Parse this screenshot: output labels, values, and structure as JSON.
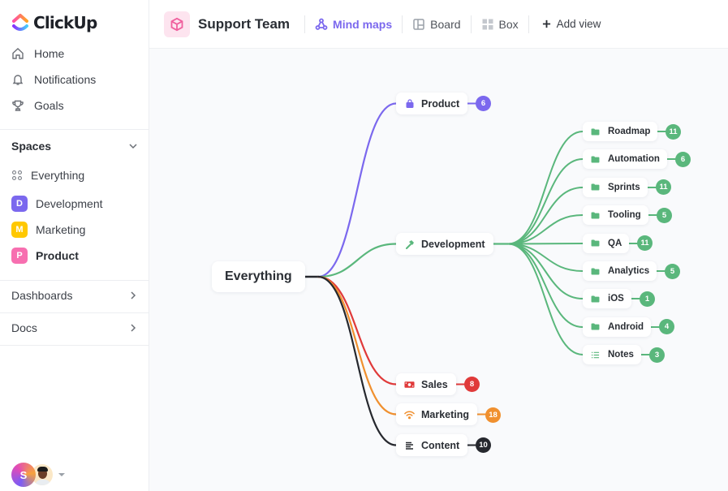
{
  "brand": {
    "name": "ClickUp"
  },
  "sidebar": {
    "nav": [
      {
        "label": "Home",
        "icon": "home-icon"
      },
      {
        "label": "Notifications",
        "icon": "bell-icon"
      },
      {
        "label": "Goals",
        "icon": "trophy-icon"
      }
    ],
    "spaces_label": "Spaces",
    "everything_label": "Everything",
    "spaces": [
      {
        "label": "Development",
        "initial": "D",
        "color": "#7b68ee"
      },
      {
        "label": "Marketing",
        "initial": "M",
        "color": "#ffc800"
      },
      {
        "label": "Product",
        "initial": "P",
        "color": "#f76fb0",
        "active": true
      }
    ],
    "dashboards_label": "Dashboards",
    "docs_label": "Docs",
    "user_initial": "S"
  },
  "header": {
    "title": "Support Team",
    "views": [
      {
        "label": "Mind maps",
        "icon": "mind-map-icon",
        "active": true
      },
      {
        "label": "Board",
        "icon": "board-icon"
      },
      {
        "label": "Box",
        "icon": "box-icon"
      }
    ],
    "add_view_label": "Add view"
  },
  "mindmap": {
    "root": "Everything",
    "colors": {
      "product": "#7b68ee",
      "development": "#5ab77c",
      "sales": "#e03a3a",
      "marketing": "#f0902f",
      "content": "#26282e"
    },
    "branches": [
      {
        "key": "product",
        "label": "Product",
        "icon": "bag-icon",
        "count": "6"
      },
      {
        "key": "development",
        "label": "Development",
        "icon": "hammer-icon",
        "count": null
      },
      {
        "key": "sales",
        "label": "Sales",
        "icon": "money-icon",
        "count": "8"
      },
      {
        "key": "marketing",
        "label": "Marketing",
        "icon": "wifi-icon",
        "count": "18"
      },
      {
        "key": "content",
        "label": "Content",
        "icon": "text-lines-icon",
        "count": "10"
      }
    ],
    "development_children": [
      {
        "label": "Roadmap",
        "icon": "folder-icon",
        "count": "11"
      },
      {
        "label": "Automation",
        "icon": "folder-icon",
        "count": "6"
      },
      {
        "label": "Sprints",
        "icon": "folder-icon",
        "count": "11"
      },
      {
        "label": "Tooling",
        "icon": "folder-icon",
        "count": "5"
      },
      {
        "label": "QA",
        "icon": "folder-icon",
        "count": "11"
      },
      {
        "label": "Analytics",
        "icon": "folder-icon",
        "count": "5"
      },
      {
        "label": "iOS",
        "icon": "folder-icon",
        "count": "1"
      },
      {
        "label": "Android",
        "icon": "folder-icon",
        "count": "4"
      },
      {
        "label": "Notes",
        "icon": "list-icon",
        "count": "3"
      }
    ]
  }
}
